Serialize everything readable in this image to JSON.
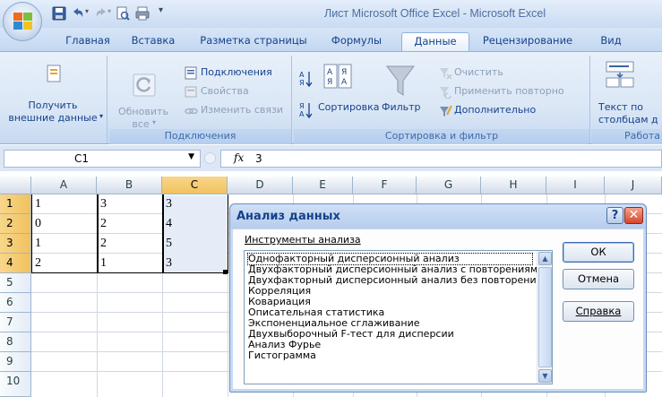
{
  "window": {
    "title": "Лист Microsoft Office Excel - Microsoft Excel"
  },
  "ribbon": {
    "tabs": [
      {
        "label": "Главная"
      },
      {
        "label": "Вставка"
      },
      {
        "label": "Разметка страницы"
      },
      {
        "label": "Формулы"
      },
      {
        "label": "Данные",
        "active": true
      },
      {
        "label": "Рецензирование"
      },
      {
        "label": "Вид"
      }
    ],
    "get_external": {
      "line1": "Получить",
      "line2": "внешние данные"
    },
    "refresh": {
      "line1": "Обновить",
      "line2": "все"
    },
    "connections": {
      "connections_label": "Подключения",
      "properties_label": "Свойства",
      "edit_links_label": "Изменить связи",
      "group_label": "Подключения"
    },
    "sort_filter": {
      "sort_label": "Сортировка",
      "filter_label": "Фильтр",
      "clear_label": "Очистить",
      "reapply_label": "Применить повторно",
      "advanced_label": "Дополнительно",
      "group_label": "Сортировка и фильтр"
    },
    "data_tools": {
      "text_to_columns_line1": "Текст по",
      "text_to_columns_line2": "столбцам д",
      "group_label": "Работа"
    }
  },
  "formula_bar": {
    "name_box": "C1",
    "fx_label": "fx",
    "value": "3"
  },
  "sheet": {
    "columns": [
      "A",
      "B",
      "C",
      "D",
      "E",
      "F",
      "G",
      "H",
      "I",
      "J"
    ],
    "selected_column": "C",
    "rows": [
      "1",
      "2",
      "3",
      "4",
      "5",
      "6",
      "7",
      "8",
      "9",
      "10"
    ],
    "selected_rows": [
      "1",
      "2",
      "3",
      "4"
    ],
    "data": [
      [
        "1",
        "3",
        "3"
      ],
      [
        "0",
        "2",
        "4"
      ],
      [
        "1",
        "2",
        "5"
      ],
      [
        "2",
        "1",
        "3"
      ]
    ]
  },
  "dialog": {
    "title": "Анализ данных",
    "help_glyph": "?",
    "close_glyph": "✕",
    "tools_label": "Инструменты анализа",
    "tools": [
      "Однофакторный дисперсионный анализ",
      "Двухфакторный дисперсионный анализ с повторениями",
      "Двухфакторный дисперсионный анализ без повторений",
      "Корреляция",
      "Ковариация",
      "Описательная статистика",
      "Экспоненциальное сглаживание",
      "Двухвыборочный F-тест для дисперсии",
      "Анализ Фурье",
      "Гистограмма"
    ],
    "selected_tool_index": 0,
    "ok_label": "ОК",
    "cancel_label": "Отмена",
    "help_label": "Справка"
  },
  "colors": {
    "ribbon_text": "#15428b",
    "selection_header": "#f1c15f",
    "close_button": "#d6462b"
  }
}
